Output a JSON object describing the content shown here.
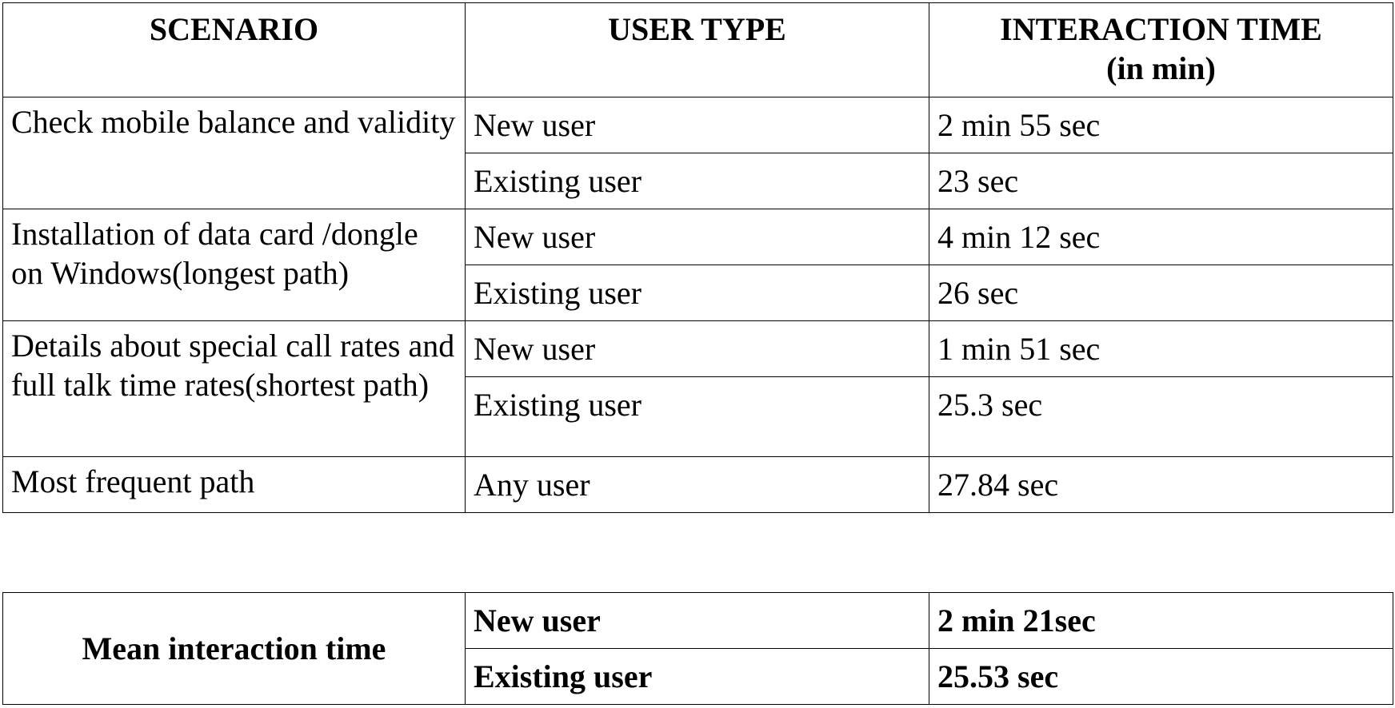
{
  "main_table": {
    "headers": {
      "scenario": "SCENARIO",
      "user_type": "USER TYPE",
      "interaction_time_line1": "INTERACTION TIME",
      "interaction_time_line2": "(in min)"
    },
    "groups": [
      {
        "scenario": "Check mobile balance and validity",
        "rows": [
          {
            "user_type": "New user",
            "time": "2 min 55 sec"
          },
          {
            "user_type": "Existing user",
            "time": "23 sec"
          }
        ]
      },
      {
        "scenario": "Installation of data card /dongle on Windows(longest path)",
        "rows": [
          {
            "user_type": "New user",
            "time": "4 min 12 sec"
          },
          {
            "user_type": "Existing user",
            "time": "26 sec"
          }
        ]
      },
      {
        "scenario": "Details about special call rates and full talk time rates(shortest path)",
        "rows": [
          {
            "user_type": "New user",
            "time": "1 min 51 sec"
          },
          {
            "user_type": "Existing user",
            "time": "25.3 sec"
          }
        ]
      },
      {
        "scenario": "Most frequent path",
        "rows": [
          {
            "user_type": "Any user",
            "time": "27.84 sec"
          }
        ]
      }
    ]
  },
  "mean_table": {
    "label": "Mean interaction time",
    "rows": [
      {
        "user_type": "New user",
        "time": "2 min 21sec"
      },
      {
        "user_type": "Existing user",
        "time": "25.53 sec"
      }
    ]
  }
}
